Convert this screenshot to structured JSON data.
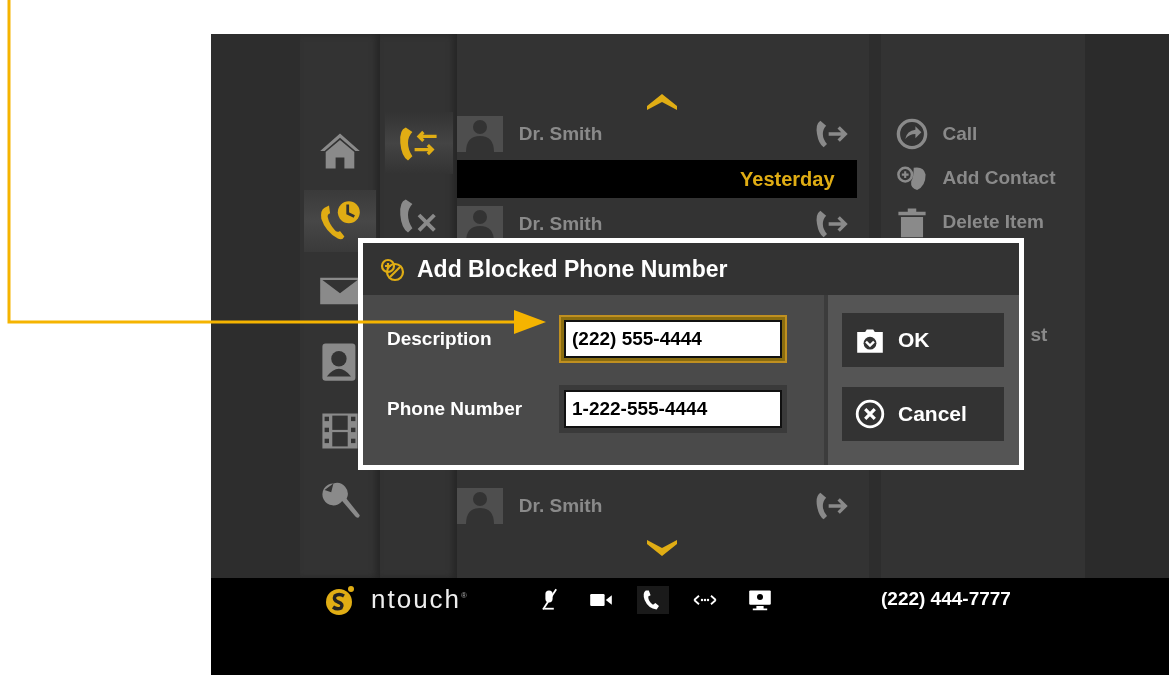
{
  "nav": [
    {
      "selected": false
    },
    {
      "selected": true
    },
    {
      "selected": false
    },
    {
      "selected": false
    },
    {
      "selected": false
    },
    {
      "selected": false
    }
  ],
  "subnav": [
    {
      "selected": true
    },
    {
      "selected": false
    }
  ],
  "list": {
    "items": [
      {
        "kind": "call",
        "name": "Dr. Smith"
      },
      {
        "kind": "header",
        "label": "Yesterday"
      },
      {
        "kind": "call",
        "name": "Dr. Smith"
      },
      {
        "kind": "hidden"
      },
      {
        "kind": "call",
        "name": "Dr. Smith"
      }
    ]
  },
  "actions": [
    {
      "label": "Call"
    },
    {
      "label": "Add Contact"
    },
    {
      "label": "Delete Item"
    },
    {
      "label": "st"
    }
  ],
  "dialog": {
    "title": "Add Blocked Phone Number",
    "fields": [
      {
        "label": "Description",
        "value": "(222) 555-4444",
        "focused": true
      },
      {
        "label": "Phone Number",
        "value": "1-222-555-4444",
        "focused": false
      }
    ],
    "buttons": [
      {
        "label": "OK"
      },
      {
        "label": "Cancel"
      }
    ]
  },
  "status_bar": {
    "brand": "ntouch$^{®}$",
    "icons": [
      {
        "selected": false
      },
      {
        "selected": false
      },
      {
        "selected": true
      },
      {
        "selected": false
      },
      {
        "selected": false
      }
    ],
    "phone": "(222) 444-7777"
  }
}
